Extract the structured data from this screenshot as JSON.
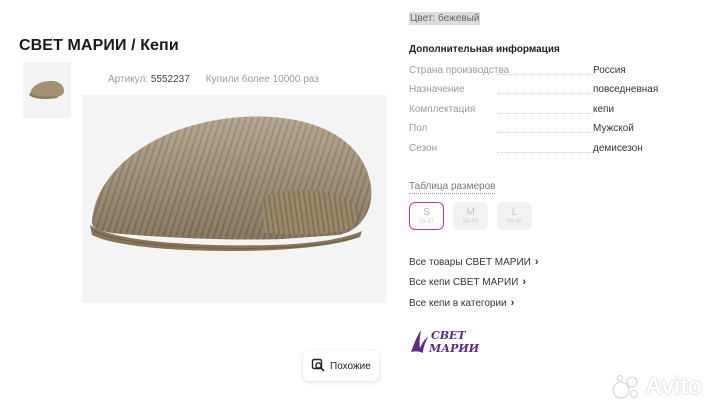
{
  "product": {
    "title": "СВЕТ МАРИИ / Кепи",
    "article_label": "Артикул:",
    "article_value": "5552237",
    "bought_text": "Купили более 10000 раз"
  },
  "similar_button": {
    "label": "Похожие",
    "icon": "search-similar-icon"
  },
  "color": {
    "label": "Цвет: бежевый",
    "swatch": "#b5a58a"
  },
  "info": {
    "title": "Дополнительная информация",
    "rows": [
      {
        "key": "Страна производства",
        "value": "Россия"
      },
      {
        "key": "Назначение",
        "value": "повседневная"
      },
      {
        "key": "Комплектация",
        "value": "кепи"
      },
      {
        "key": "Пол",
        "value": "Мужской"
      },
      {
        "key": "Сезон",
        "value": "демисезон"
      }
    ]
  },
  "sizes": {
    "title": "Таблица размеров",
    "items": [
      {
        "size": "S",
        "range": "56-57",
        "selected": true
      },
      {
        "size": "M",
        "range": "58-59",
        "selected": false
      },
      {
        "size": "L",
        "range": "59-60",
        "selected": false
      }
    ],
    "accent": "#b43aa8"
  },
  "links": [
    {
      "label": "Все товары СВЕТ МАРИИ"
    },
    {
      "label": "Все кепи СВЕТ МАРИИ"
    },
    {
      "label": "Все кепи в категории"
    }
  ],
  "brand": {
    "line1": "СВЕТ",
    "line2": "МАРИИ",
    "color": "#5a2a84"
  },
  "watermark": {
    "text": "Avito"
  }
}
